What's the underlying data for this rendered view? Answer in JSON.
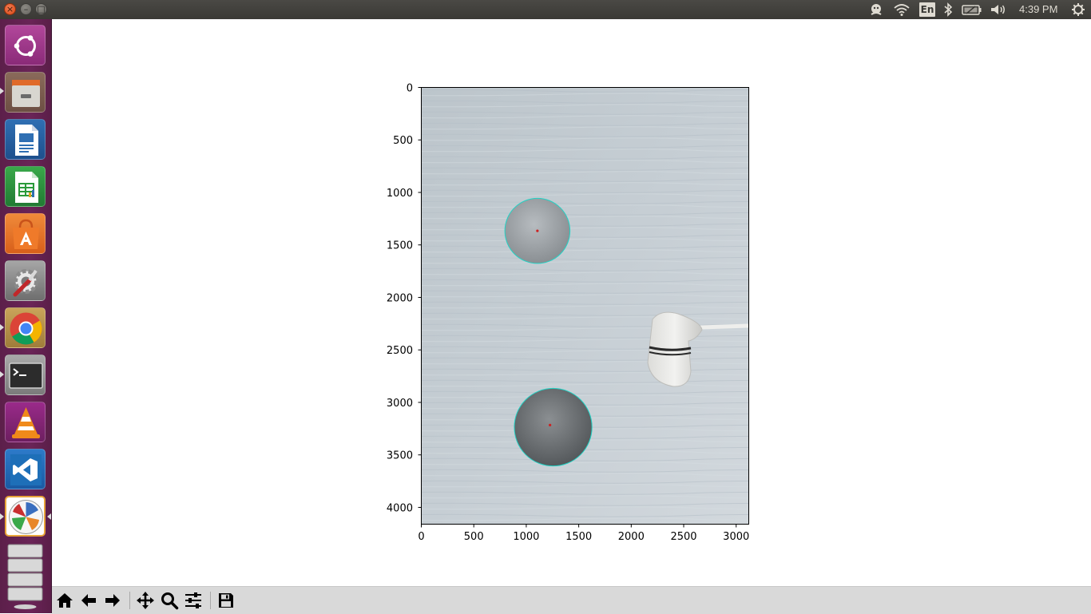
{
  "top_panel": {
    "window_buttons": {
      "close": "×",
      "minimize": "–",
      "maximize": "□"
    },
    "language": "En",
    "clock": "4:39 PM",
    "tray_icons": [
      "indicator-icon",
      "wifi-icon",
      "bluetooth-icon",
      "battery-icon",
      "volume-icon",
      "power-gear-icon"
    ]
  },
  "launcher": {
    "items": [
      {
        "name": "ubuntu-dash-icon"
      },
      {
        "name": "files-icon"
      },
      {
        "name": "libreoffice-writer-icon"
      },
      {
        "name": "libreoffice-calc-icon"
      },
      {
        "name": "software-center-icon"
      },
      {
        "name": "system-settings-icon"
      },
      {
        "name": "chrome-icon"
      },
      {
        "name": "terminal-icon"
      },
      {
        "name": "vlc-icon"
      },
      {
        "name": "vscode-icon"
      },
      {
        "name": "matplotlib-figure-icon"
      },
      {
        "name": "trash-workspaces-icon"
      }
    ],
    "colors": {
      "bg": "#6a2457"
    }
  },
  "chart_data": {
    "type": "image",
    "xlim": [
      0,
      3120
    ],
    "ylim": [
      4160,
      0
    ],
    "xticks": [
      0,
      500,
      1000,
      1500,
      2000,
      2500,
      3000
    ],
    "yticks": [
      0,
      500,
      1000,
      1500,
      2000,
      2500,
      3000,
      3500,
      4000
    ],
    "detected_circles": [
      {
        "cx": 1110,
        "cy": 1370,
        "r": 310,
        "color": "#22d3c5"
      },
      {
        "cx": 1260,
        "cy": 3240,
        "r": 370,
        "color": "#22d3c5"
      }
    ],
    "center_markers": [
      {
        "x": 1110,
        "y": 1370,
        "color": "#cc2222"
      },
      {
        "x": 1230,
        "y": 3220,
        "color": "#cc2222"
      }
    ],
    "grid": false
  },
  "toolbar": {
    "buttons": [
      {
        "name": "home-button",
        "icon": "home-icon",
        "title": "Reset original view"
      },
      {
        "name": "back-button",
        "icon": "arrow-left-icon",
        "title": "Back to previous view"
      },
      {
        "name": "forward-button",
        "icon": "arrow-right-icon",
        "title": "Forward to next view"
      },
      {
        "name": "pan-button",
        "icon": "move-icon",
        "title": "Pan axes"
      },
      {
        "name": "zoom-button",
        "icon": "magnifier-icon",
        "title": "Zoom to rectangle"
      },
      {
        "name": "configure-subplots-button",
        "icon": "sliders-icon",
        "title": "Configure subplots"
      },
      {
        "name": "save-button",
        "icon": "floppy-disk-icon",
        "title": "Save the figure"
      }
    ]
  }
}
